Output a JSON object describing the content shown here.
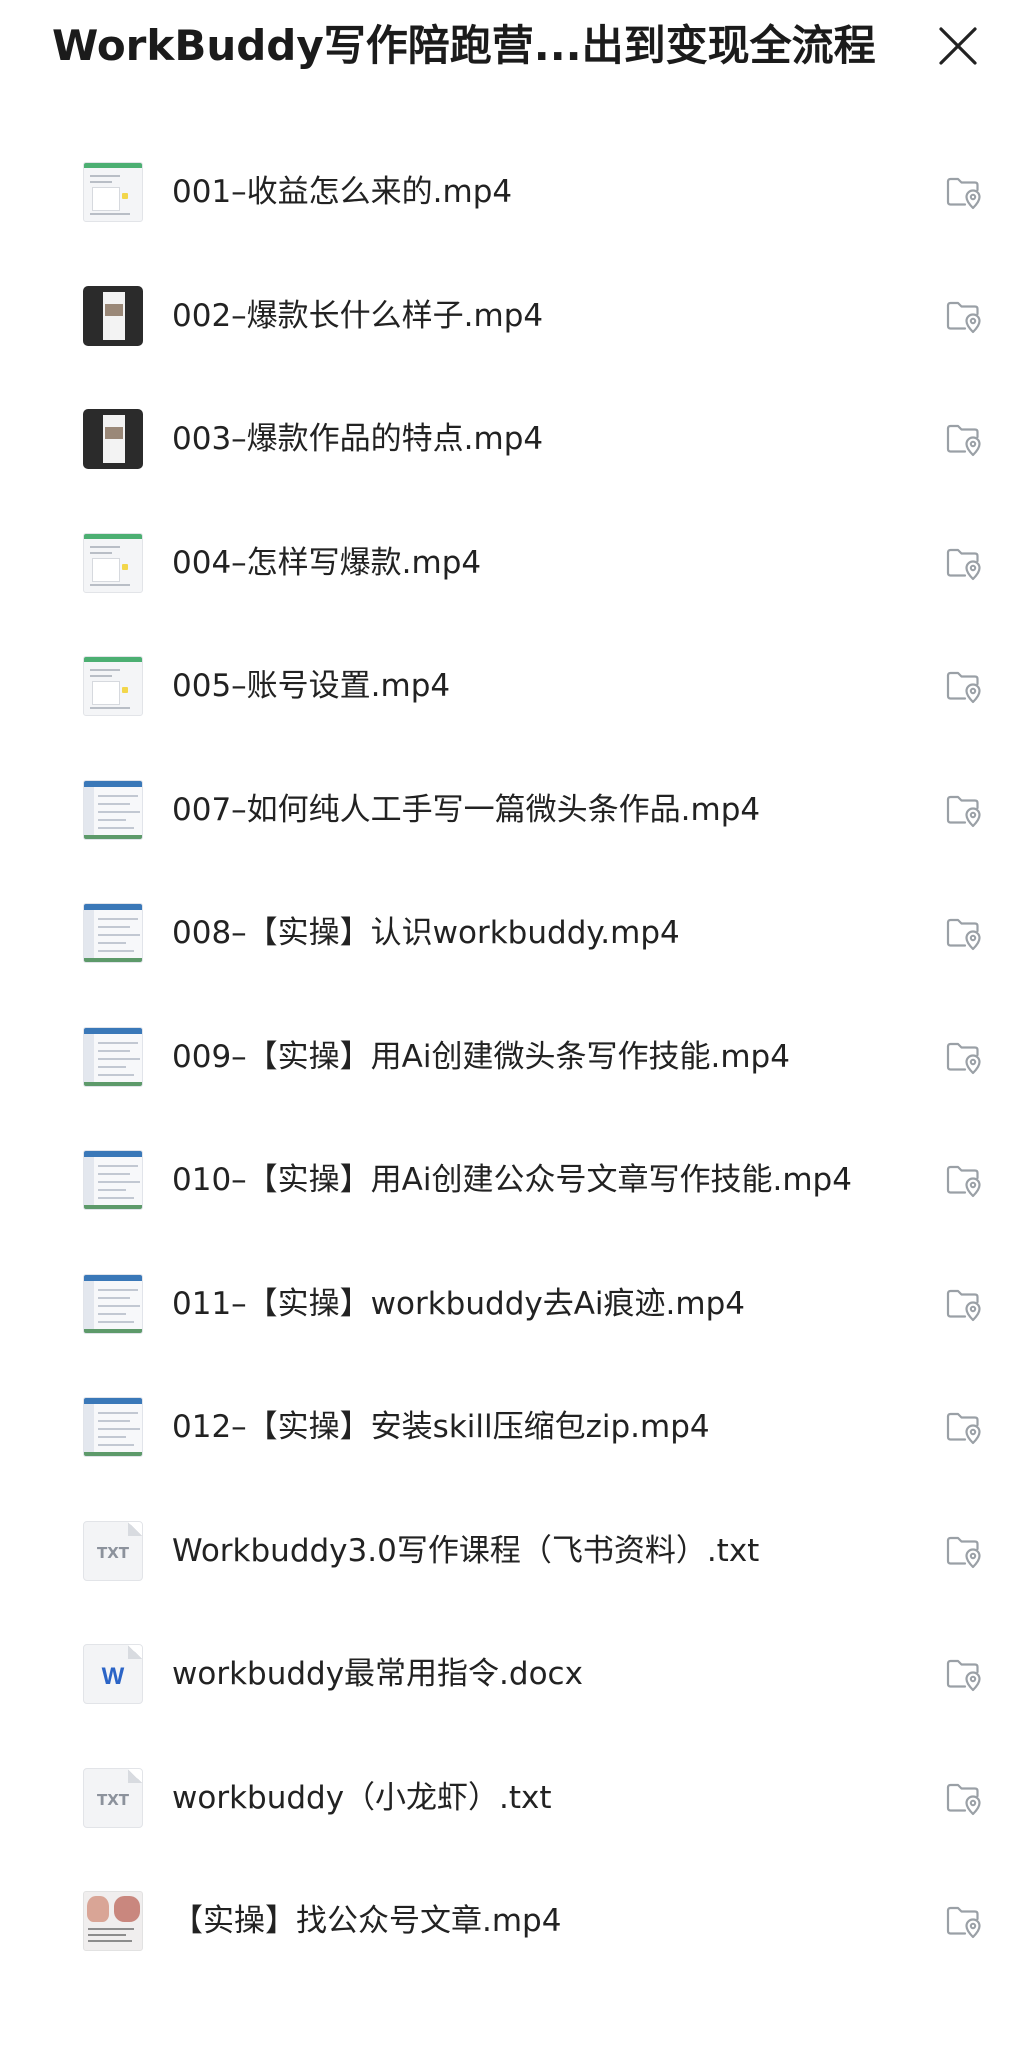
{
  "header": {
    "title": "WorkBuddy写作陪跑营...出到变现全流程",
    "close_icon": "close-icon"
  },
  "files": [
    {
      "name": "001–收益怎么来的.mp4",
      "thumb": "screen"
    },
    {
      "name": "002–爆款长什么样子.mp4",
      "thumb": "dark"
    },
    {
      "name": "003–爆款作品的特点.mp4",
      "thumb": "dark"
    },
    {
      "name": "004–怎样写爆款.mp4",
      "thumb": "screen"
    },
    {
      "name": "005–账号设置.mp4",
      "thumb": "screen"
    },
    {
      "name": "007–如何纯人工手写一篇微头条作品.mp4",
      "thumb": "blue"
    },
    {
      "name": "008–【实操】认识workbuddy.mp4",
      "thumb": "blue"
    },
    {
      "name": "009–【实操】用Ai创建微头条写作技能.mp4",
      "thumb": "blue"
    },
    {
      "name": "010–【实操】用Ai创建公众号文章写作技能.mp4",
      "thumb": "blue"
    },
    {
      "name": "011–【实操】workbuddy去Ai痕迹.mp4",
      "thumb": "blue"
    },
    {
      "name": "012–【实操】安装skill压缩包zip.mp4",
      "thumb": "blue"
    },
    {
      "name": "Workbuddy3.0写作课程（飞书资料）.txt",
      "thumb": "txt",
      "ext_label": "TXT"
    },
    {
      "name": "workbuddy最常用指令.docx",
      "thumb": "word",
      "ext_label": "W"
    },
    {
      "name": "workbuddy（小龙虾）.txt",
      "thumb": "txt",
      "ext_label": "TXT"
    },
    {
      "name": "【实操】找公众号文章.mp4",
      "thumb": "photo"
    }
  ],
  "row_action_icon": "folder-location-icon",
  "colors": {
    "text": "#222222",
    "icon_gray": "#9aa0a6",
    "accent_word": "#2b64c6"
  }
}
